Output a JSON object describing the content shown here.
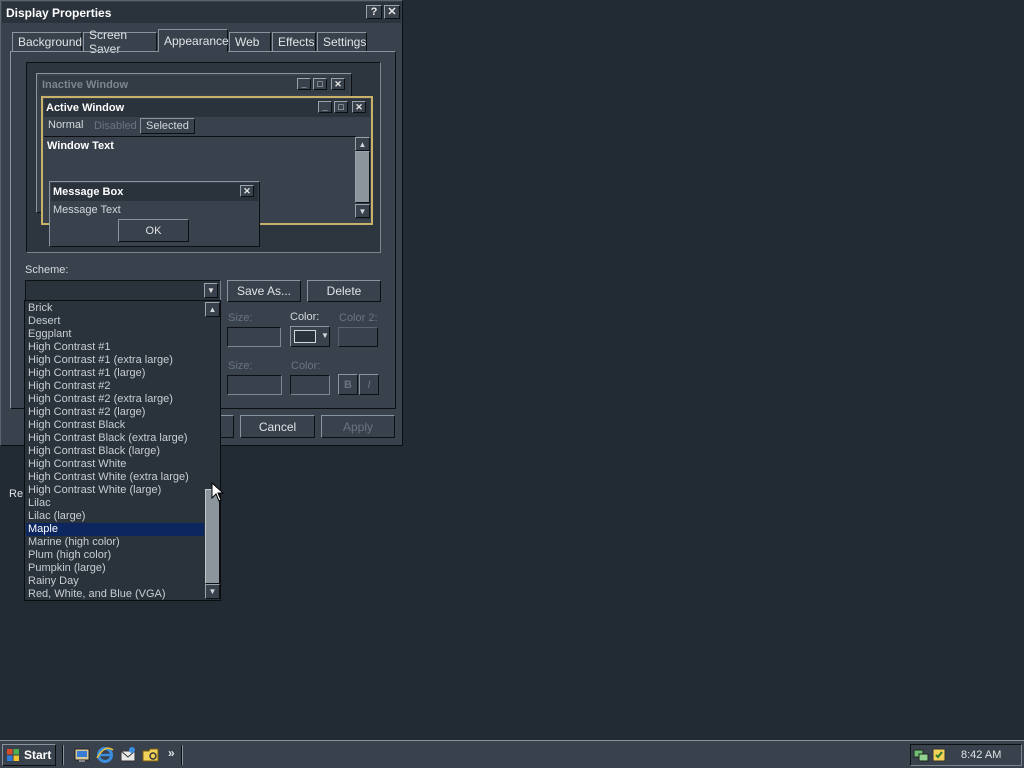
{
  "dialog": {
    "title": "Display Properties",
    "help_glyph": "?",
    "close_glyph": "✕",
    "tabs": [
      {
        "label": "Background"
      },
      {
        "label": "Screen Saver"
      },
      {
        "label": "Appearance"
      },
      {
        "label": "Web"
      },
      {
        "label": "Effects"
      },
      {
        "label": "Settings"
      }
    ],
    "active_tab": "Appearance"
  },
  "preview": {
    "inactive_title": "Inactive Window",
    "active_title": "Active Window",
    "menu_normal": "Normal",
    "menu_disabled": "Disabled",
    "menu_selected": "Selected",
    "window_text": "Window Text",
    "message_box_title": "Message Box",
    "message_text": "Message Text",
    "ok_label": "OK"
  },
  "scheme": {
    "label": "Scheme:",
    "value": "",
    "save_as_label": "Save As...",
    "delete_label": "Delete",
    "options": [
      "Brick",
      "Desert",
      "Eggplant",
      "High Contrast #1",
      "High Contrast #1 (extra large)",
      "High Contrast #1 (large)",
      "High Contrast #2",
      "High Contrast #2 (extra large)",
      "High Contrast #2 (large)",
      "High Contrast Black",
      "High Contrast Black (extra large)",
      "High Contrast Black (large)",
      "High Contrast White",
      "High Contrast White (extra large)",
      "High Contrast White (large)",
      "Lilac",
      "Lilac (large)",
      "Maple",
      "Marine (high color)",
      "Plum (high color)",
      "Pumpkin (large)",
      "Rainy Day",
      "Red, White, and Blue (VGA)"
    ],
    "highlighted": "Maple"
  },
  "item_props": {
    "size_label": "Size:",
    "color_label": "Color:",
    "color2_label": "Color 2:",
    "bold_label": "B",
    "italic_label": "I"
  },
  "footer": {
    "ok_label": "",
    "cancel_label": "Cancel",
    "apply_label": "Apply"
  },
  "desktop": {
    "clipped_icon_label": "Re"
  },
  "taskbar": {
    "start_label": "Start",
    "chevron": "»",
    "clock": "8:42 AM"
  },
  "colors": {
    "desktop": "#222a33",
    "window_face": "#39424c",
    "title_bar": "#2a323b",
    "selection": "#0c2660",
    "active_frame": "#c8b26a"
  }
}
